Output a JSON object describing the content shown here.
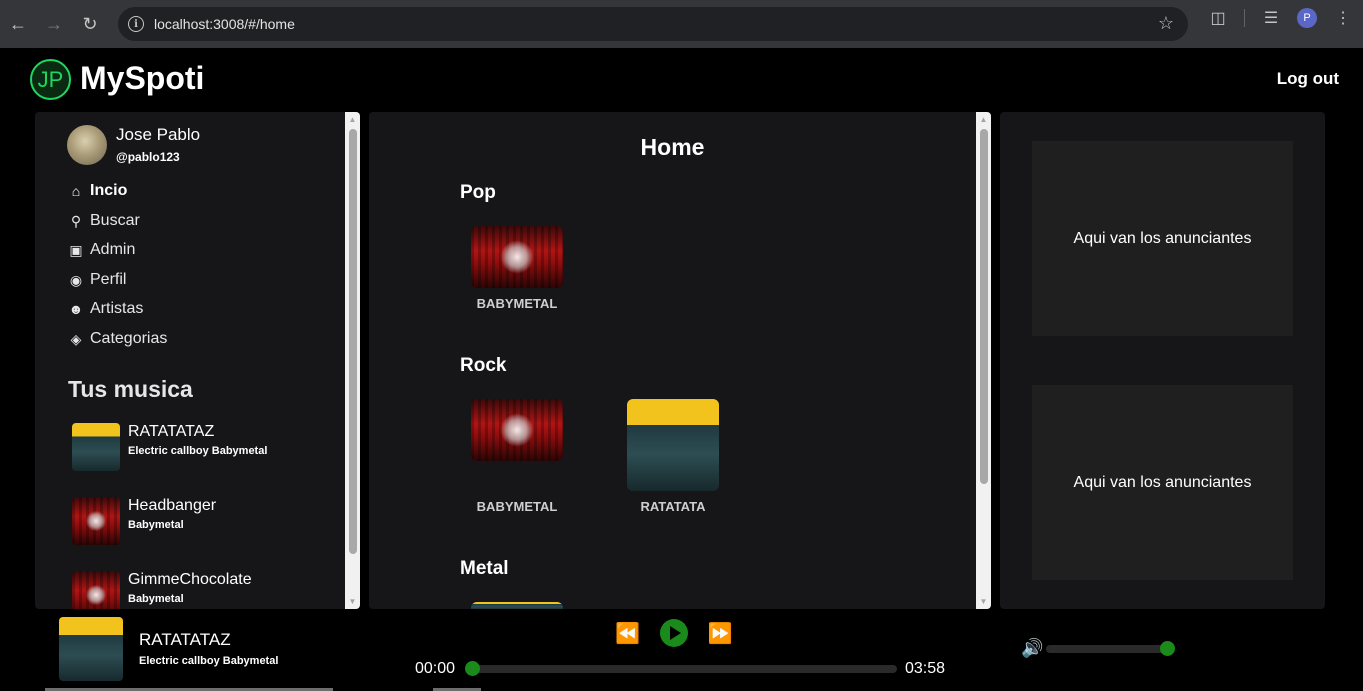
{
  "browser": {
    "url": "localhost:3008/#/home",
    "profile_initial": "P"
  },
  "header": {
    "logo_text": "JP",
    "brand": "MySpoti",
    "logout_label": "Log out"
  },
  "user": {
    "name": "Jose Pablo",
    "handle": "@pablo123"
  },
  "nav": [
    {
      "label": "Incio",
      "icon": "home-icon",
      "active": true
    },
    {
      "label": "Buscar",
      "icon": "search-icon"
    },
    {
      "label": "Admin",
      "icon": "briefcase-icon"
    },
    {
      "label": "Perfil",
      "icon": "user-circle-icon"
    },
    {
      "label": "Artistas",
      "icon": "users-icon"
    },
    {
      "label": "Categorias",
      "icon": "tag-icon"
    }
  ],
  "library": {
    "title": "Tus musica",
    "songs": [
      {
        "title": "RATATATAZ",
        "artists": "Electric callboy   Babymetal",
        "cover": "ratatata"
      },
      {
        "title": "Headbanger",
        "artists": "Babymetal",
        "cover": "babymetal"
      },
      {
        "title": "GimmeChocolate",
        "artists": "Babymetal",
        "cover": "babymetal"
      }
    ]
  },
  "main": {
    "title": "Home",
    "genres": [
      {
        "name": "Pop",
        "items": [
          {
            "label": "BABYMETAL",
            "cover": "babymetal"
          }
        ]
      },
      {
        "name": "Rock",
        "items": [
          {
            "label": "BABYMETAL",
            "cover": "babymetal"
          },
          {
            "label": "RATATATA",
            "cover": "ratatata"
          }
        ]
      },
      {
        "name": "Metal",
        "items": []
      }
    ]
  },
  "ads": [
    {
      "text": "Aqui van los anunciantes"
    },
    {
      "text": "Aqui van los anunciantes"
    }
  ],
  "player": {
    "title": "RATATATAZ",
    "artists": "Electric callboy  Babymetal",
    "current_time": "00:00",
    "duration": "03:58",
    "progress": 0,
    "volume": 1.0,
    "accent_color": "#1a8a1a"
  }
}
